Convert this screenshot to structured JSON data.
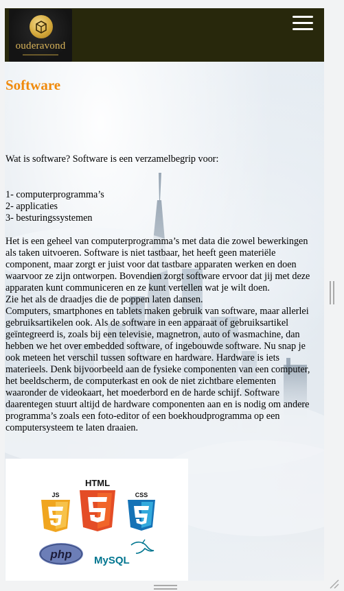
{
  "header": {
    "logo_text": "ouderavond",
    "menu_icon": "hamburger-menu-icon"
  },
  "article": {
    "title": "Software",
    "intro": "Wat is software? Software is een verzamelbegrip voor:",
    "list": [
      "1- computerprogramma’s",
      "2- applicaties",
      "3- besturingssystemen"
    ],
    "body_lines": [
      "Het is een geheel van computerprogramma’s met data die zowel bewerkingen",
      "als taken uitvoeren. Software is niet tastbaar, het heeft geen materiële",
      "component, maar zorgt er juist voor dat tastbare apparaten werken en doen",
      "waarvoor ze zijn ontworpen. Bovendien zorgt software ervoor dat jij met deze",
      "apparaten kunt communiceren en ze kunt vertellen wat je wilt doen.",
      "Zie het als de draadjes die de poppen laten dansen.",
      "Computers, smartphones en tablets maken gebruik van software, maar allerlei",
      "gebruiksartikelen ook. Als de software in een apparaat of gebruiksartikel",
      "geïntegreerd is, zoals bij een televisie, magnetron, auto of wasmachine, dan",
      "hebben we het over embedded software, of ingebouwde software. Nu snap je",
      "ook meteen het verschil tussen software en hardware. Hardware is iets",
      "materieels. Denk bijvoorbeeld aan de fysieke componenten van een computer,",
      "het beeldscherm, de computerkast en ook de niet zichtbare elementen",
      "waaronder de videokaart, het moederbord en de harde schijf. Software",
      "daarentegen stuurt altijd de hardware componenten aan en is nodig om andere",
      "programma’s zoals een foto-editor of een boekhoudprogramma op een",
      "computersysteem te laten draaien."
    ]
  },
  "tech_logos": {
    "js": "JS",
    "html": "HTML",
    "css": "CSS",
    "php": "php",
    "mysql": "MySQL",
    "js_color": "#f0a51f",
    "html_color": "#e44d26",
    "css_color": "#2965f1",
    "php_color": "#6c7eb7",
    "mysql_color": "#00758f"
  }
}
